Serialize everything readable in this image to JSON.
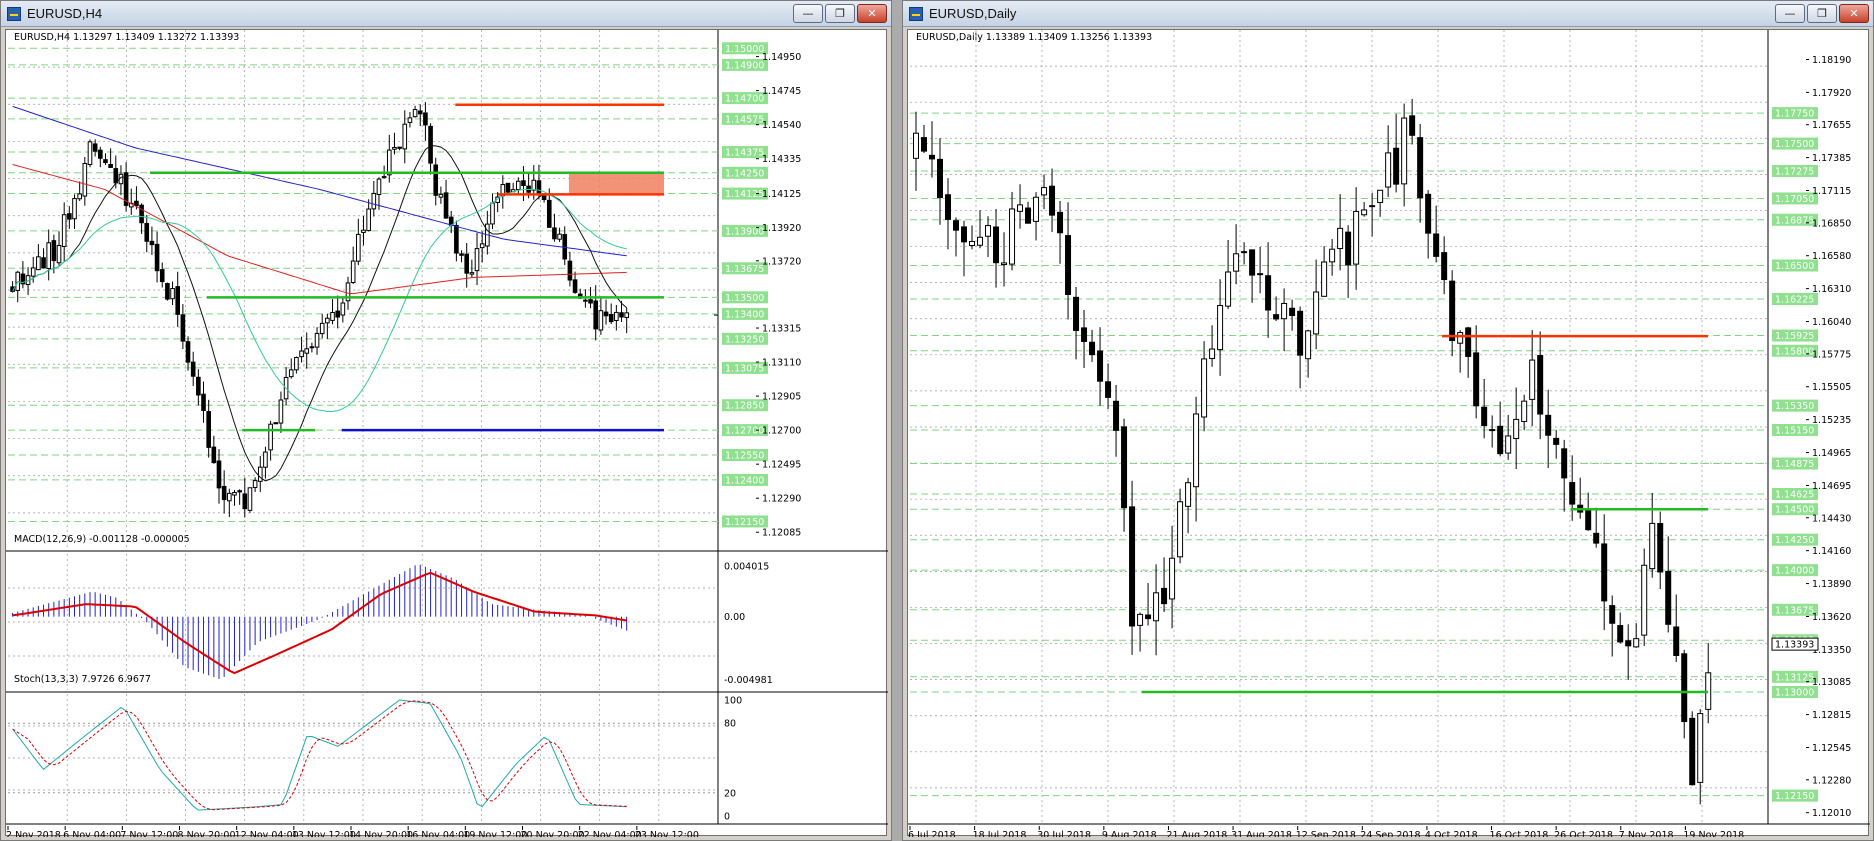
{
  "left_window": {
    "title": "EURUSD,H4",
    "buttons": [
      "minimize",
      "restore",
      "close"
    ],
    "price_pane": {
      "header": "EURUSD,H4  1.13297 1.13409 1.13272 1.13393",
      "price_range": [
        1.1199,
        1.1505
      ],
      "price_scale": [
        "1.14950",
        "1.14745",
        "1.14540",
        "1.14335",
        "1.14125",
        "1.13920",
        "1.13720",
        "1.13315",
        "1.13110",
        "1.12905",
        "1.12700",
        "1.12495",
        "1.12290",
        "1.12085"
      ],
      "green_level_tags": [
        "1.15000",
        "1.14900",
        "1.14700",
        "1.14575",
        "1.14375",
        "1.14250",
        "1.14125",
        "1.13900",
        "1.13675",
        "1.13500",
        "1.13400",
        "1.13250",
        "1.13075",
        "1.12850",
        "1.12700",
        "1.12550",
        "1.12400",
        "1.12150"
      ],
      "current_price": "1.13393",
      "horizontal_lines": [
        {
          "name": "resistance-red-top",
          "price": 1.1466,
          "color": "#ff3300",
          "from": 0.63,
          "to": 1.0
        },
        {
          "name": "support-green-upper",
          "price": 1.1425,
          "color": "#22bb22",
          "from": 0.2,
          "to": 1.0
        },
        {
          "name": "resistance-red-mid",
          "price": 1.1412,
          "color": "#ff3300",
          "from": 0.69,
          "to": 1.0
        },
        {
          "name": "support-green-mid",
          "price": 1.135,
          "color": "#22bb22",
          "from": 0.28,
          "to": 1.0
        },
        {
          "name": "support-green-low",
          "price": 1.127,
          "color": "#22bb22",
          "from": 0.33,
          "to": 0.47
        },
        {
          "name": "support-blue-low",
          "price": 1.127,
          "color": "#1010cc",
          "from": 0.47,
          "to": 1.0
        }
      ],
      "zone": {
        "price_top": 1.1425,
        "price_bottom": 1.1412,
        "from": 0.79,
        "to": 1.0,
        "color": "#f08060"
      }
    },
    "macd_pane": {
      "header": "MACD(12,26,9) -0.001128 -0.000005",
      "scale": [
        "0.004015",
        "0.00",
        "-0.004981"
      ],
      "range": [
        -0.0055,
        0.0045
      ]
    },
    "stoch_pane": {
      "header": "Stoch(13,3,3) 7.9726 6.9677",
      "scale": [
        "100",
        "80",
        "20",
        "0"
      ]
    },
    "time_axis": [
      "2 Nov 2018",
      "6 Nov 04:00",
      "7 Nov 12:00",
      "8 Nov 20:00",
      "12 Nov 04:00",
      "13 Nov 12:00",
      "14 Nov 20:00",
      "16 Nov 04:00",
      "19 Nov 12:00",
      "20 Nov 20:00",
      "22 Nov 04:00",
      "23 Nov 12:00"
    ]
  },
  "right_window": {
    "title": "EURUSD,Daily",
    "buttons": [
      "minimize",
      "restore",
      "close"
    ],
    "price_pane": {
      "header": "EURUSD,Daily  1.13389 1.13409 1.13256 1.13393",
      "price_range": [
        1.1195,
        1.1835
      ],
      "price_scale": [
        "1.18190",
        "1.17920",
        "1.17655",
        "1.17385",
        "1.17115",
        "1.16850",
        "1.16580",
        "1.16310",
        "1.16040",
        "1.15775",
        "1.15505",
        "1.15235",
        "1.14965",
        "1.14695",
        "1.14430",
        "1.14160",
        "1.13890",
        "1.13620",
        "1.13350",
        "1.13085",
        "1.12815",
        "1.12545",
        "1.12280",
        "1.12010"
      ],
      "green_level_tags": [
        "1.17750",
        "1.17500",
        "1.17275",
        "1.17050",
        "1.16875",
        "1.16500",
        "1.16225",
        "1.15925",
        "1.15800",
        "1.15350",
        "1.15150",
        "1.14875",
        "1.14625",
        "1.14500",
        "1.14250",
        "1.14000",
        "1.13675",
        "1.13425",
        "1.13125",
        "1.13000",
        "1.12150"
      ],
      "current_price": "1.13393",
      "horizontal_lines": [
        {
          "name": "resistance-red",
          "price": 1.1592,
          "color": "#ff3300",
          "from": 0.62,
          "to": 1.0
        },
        {
          "name": "support-green-upper",
          "price": 1.145,
          "color": "#22bb22",
          "from": 0.77,
          "to": 1.0
        },
        {
          "name": "support-green-lower",
          "price": 1.13,
          "color": "#22bb22",
          "from": 0.27,
          "to": 1.0
        }
      ]
    },
    "time_axis": [
      "6 Jul 2018",
      "18 Jul 2018",
      "30 Jul 2018",
      "9 Aug 2018",
      "21 Aug 2018",
      "31 Aug 2018",
      "12 Sep 2018",
      "24 Sep 2018",
      "4 Oct 2018",
      "16 Oct 2018",
      "26 Oct 2018",
      "7 Nov 2018",
      "19 Nov 2018"
    ]
  },
  "colors": {
    "grid": "#9a9a9a",
    "level_line": "#7fd67f",
    "level_tag": "#8fe08f",
    "candle": "#000000",
    "ma_blue": "#2222cc",
    "ma_red": "#dd2222",
    "ma_black": "#111111",
    "ma_aqua": "#33cc99",
    "macd_hist": "#2222cc",
    "macd_signal": "#dd0000",
    "stoch_main": "#22aaaa",
    "stoch_signal": "#dd0000"
  }
}
